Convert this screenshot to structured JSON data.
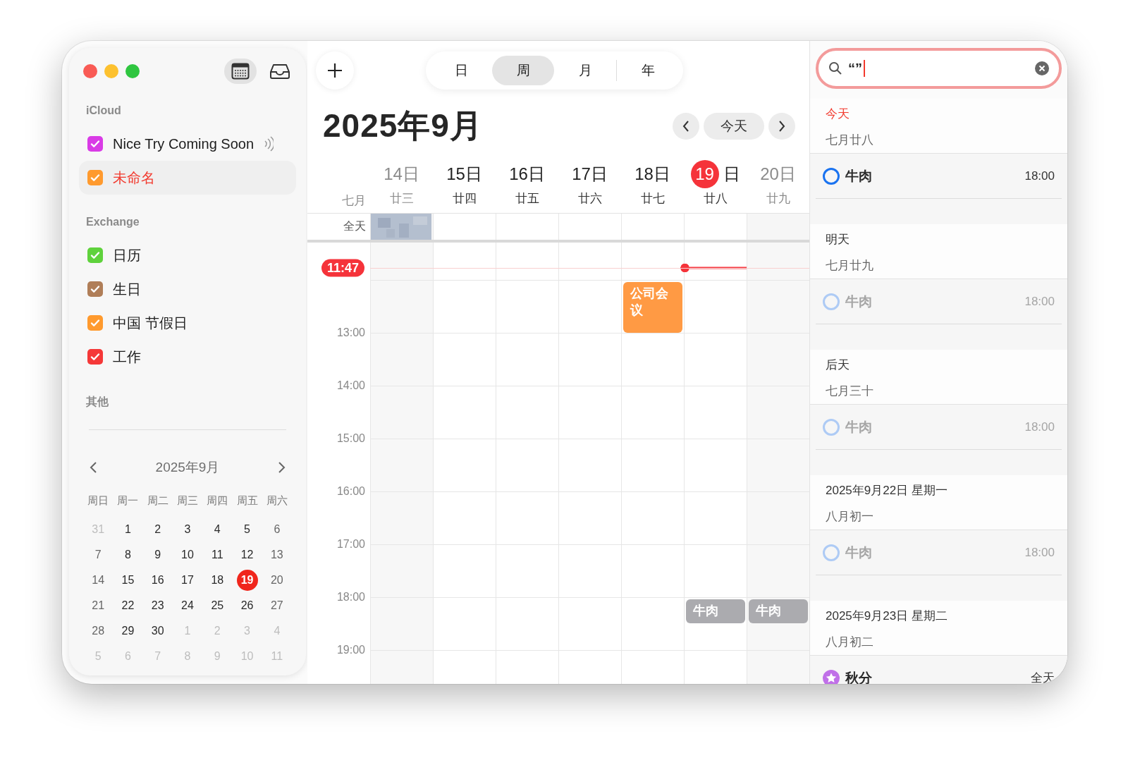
{
  "view_switcher": [
    {
      "label": "日",
      "selected": false
    },
    {
      "label": "周",
      "selected": true
    },
    {
      "label": "月",
      "selected": false
    },
    {
      "label": "年",
      "selected": false
    }
  ],
  "sidebar": {
    "groups": [
      {
        "title": "iCloud",
        "calendars": [
          {
            "name": "Nice Try Coming Soon",
            "color": "#d93be6",
            "checked": true,
            "selected": false,
            "shared": true
          },
          {
            "name": "未命名",
            "color": "#ff9a2e",
            "checked": true,
            "selected": true,
            "shared": false
          }
        ]
      },
      {
        "title": "Exchange",
        "calendars": [
          {
            "name": "日历",
            "color": "#5fd23c",
            "checked": true,
            "selected": false,
            "shared": false
          },
          {
            "name": "生日",
            "color": "#b07e58",
            "checked": true,
            "selected": false,
            "shared": false
          },
          {
            "name": "中国 节假日",
            "color": "#ff9a2e",
            "checked": true,
            "selected": false,
            "shared": false
          },
          {
            "name": "工作",
            "color": "#f53838",
            "checked": true,
            "selected": false,
            "shared": false
          }
        ]
      },
      {
        "title": "其他"
      }
    ],
    "mini_calendar": {
      "title": "2025年9月",
      "weekdays": [
        "周日",
        "周一",
        "周二",
        "周三",
        "周四",
        "周五",
        "周六"
      ],
      "weeks": [
        [
          {
            "day": "31",
            "outside": true,
            "today": false
          },
          {
            "day": "1",
            "outside": false,
            "today": false
          },
          {
            "day": "2",
            "outside": false,
            "today": false
          },
          {
            "day": "3",
            "outside": false,
            "today": false
          },
          {
            "day": "4",
            "outside": false,
            "today": false
          },
          {
            "day": "5",
            "outside": false,
            "today": false
          },
          {
            "day": "6",
            "outside": false,
            "today": false
          }
        ],
        [
          {
            "day": "7",
            "outside": false,
            "today": false
          },
          {
            "day": "8",
            "outside": false,
            "today": false
          },
          {
            "day": "9",
            "outside": false,
            "today": false
          },
          {
            "day": "10",
            "outside": false,
            "today": false
          },
          {
            "day": "11",
            "outside": false,
            "today": false
          },
          {
            "day": "12",
            "outside": false,
            "today": false
          },
          {
            "day": "13",
            "outside": false,
            "today": false
          }
        ],
        [
          {
            "day": "14",
            "outside": false,
            "today": false
          },
          {
            "day": "15",
            "outside": false,
            "today": false
          },
          {
            "day": "16",
            "outside": false,
            "today": false
          },
          {
            "day": "17",
            "outside": false,
            "today": false
          },
          {
            "day": "18",
            "outside": false,
            "today": false
          },
          {
            "day": "19",
            "outside": false,
            "today": true
          },
          {
            "day": "20",
            "outside": false,
            "today": false
          }
        ],
        [
          {
            "day": "21",
            "outside": false,
            "today": false
          },
          {
            "day": "22",
            "outside": false,
            "today": false
          },
          {
            "day": "23",
            "outside": false,
            "today": false
          },
          {
            "day": "24",
            "outside": false,
            "today": false
          },
          {
            "day": "25",
            "outside": false,
            "today": false
          },
          {
            "day": "26",
            "outside": false,
            "today": false
          },
          {
            "day": "27",
            "outside": false,
            "today": false
          }
        ],
        [
          {
            "day": "28",
            "outside": false,
            "today": false
          },
          {
            "day": "29",
            "outside": false,
            "today": false
          },
          {
            "day": "30",
            "outside": false,
            "today": false
          },
          {
            "day": "1",
            "outside": true,
            "today": false
          },
          {
            "day": "2",
            "outside": true,
            "today": false
          },
          {
            "day": "3",
            "outside": true,
            "today": false
          },
          {
            "day": "4",
            "outside": true,
            "today": false
          }
        ],
        [
          {
            "day": "5",
            "outside": true,
            "today": false
          },
          {
            "day": "6",
            "outside": true,
            "today": false
          },
          {
            "day": "7",
            "outside": true,
            "today": false
          },
          {
            "day": "8",
            "outside": true,
            "today": false
          },
          {
            "day": "9",
            "outside": true,
            "today": false
          },
          {
            "day": "10",
            "outside": true,
            "today": false
          },
          {
            "day": "11",
            "outside": true,
            "today": false
          }
        ]
      ]
    }
  },
  "main": {
    "title": "2025年9月",
    "today_button": "今天",
    "month_label": "七月",
    "all_day_label": "全天",
    "now": "11:47",
    "days": [
      {
        "date": "14日",
        "lunar": "廿三",
        "weekend": true,
        "today": false,
        "all_day_redacted": true
      },
      {
        "date": "15日",
        "lunar": "廿四",
        "weekend": false,
        "today": false
      },
      {
        "date": "16日",
        "lunar": "廿五",
        "weekend": false,
        "today": false
      },
      {
        "date": "17日",
        "lunar": "廿六",
        "weekend": false,
        "today": false
      },
      {
        "date": "18日",
        "lunar": "廿七",
        "weekend": false,
        "today": false
      },
      {
        "date": "19",
        "date_suffix": "日",
        "lunar": "廿八",
        "weekend": false,
        "today": true
      },
      {
        "date": "20日",
        "lunar": "廿九",
        "weekend": true,
        "today": false
      }
    ],
    "hour_rows": [
      {
        "cells": [
          {
            "kind": "empty"
          },
          {
            "kind": "empty"
          },
          {
            "kind": "empty"
          },
          {
            "kind": "empty"
          },
          {
            "kind": "long",
            "title": "公司会议",
            "color": "#ff9a44"
          },
          {
            "kind": "empty"
          },
          {
            "kind": "empty"
          }
        ]
      },
      {
        "label": "13:00"
      },
      {
        "label": "14:00"
      },
      {
        "label": "15:00"
      },
      {
        "label": "16:00"
      },
      {
        "label": "17:00"
      },
      {
        "label": "18:00",
        "cells": [
          {
            "kind": "empty"
          },
          {
            "kind": "empty"
          },
          {
            "kind": "empty"
          },
          {
            "kind": "empty"
          },
          {
            "kind": "empty"
          },
          {
            "kind": "short",
            "title": "牛肉",
            "color": "#ababaf"
          },
          {
            "kind": "short",
            "title": "牛肉",
            "color": "#ababaf"
          }
        ]
      },
      {
        "label": "19:00"
      }
    ]
  },
  "search": {
    "value": "“”",
    "sections": [
      {
        "title": "今天",
        "lunar": "七月廿八",
        "today": true,
        "items": [
          {
            "kind": "event",
            "title": "牛肉",
            "time": "18:00",
            "dimmed": false
          }
        ]
      },
      {
        "title": "明天",
        "lunar": "七月廿九",
        "today": false,
        "items": [
          {
            "kind": "event",
            "title": "牛肉",
            "time": "18:00",
            "dimmed": true
          }
        ]
      },
      {
        "title": "后天",
        "lunar": "七月三十",
        "today": false,
        "items": [
          {
            "kind": "event",
            "title": "牛肉",
            "time": "18:00",
            "dimmed": true
          }
        ]
      },
      {
        "title": "2025年9月22日 星期一",
        "lunar": "八月初一",
        "today": false,
        "items": [
          {
            "kind": "event",
            "title": "牛肉",
            "time": "18:00",
            "dimmed": true
          }
        ]
      },
      {
        "title": "2025年9月23日 星期二",
        "lunar": "八月初二",
        "today": false,
        "items": [
          {
            "kind": "holiday",
            "title": "秋分",
            "time": "全天",
            "dimmed": false
          }
        ]
      }
    ]
  }
}
